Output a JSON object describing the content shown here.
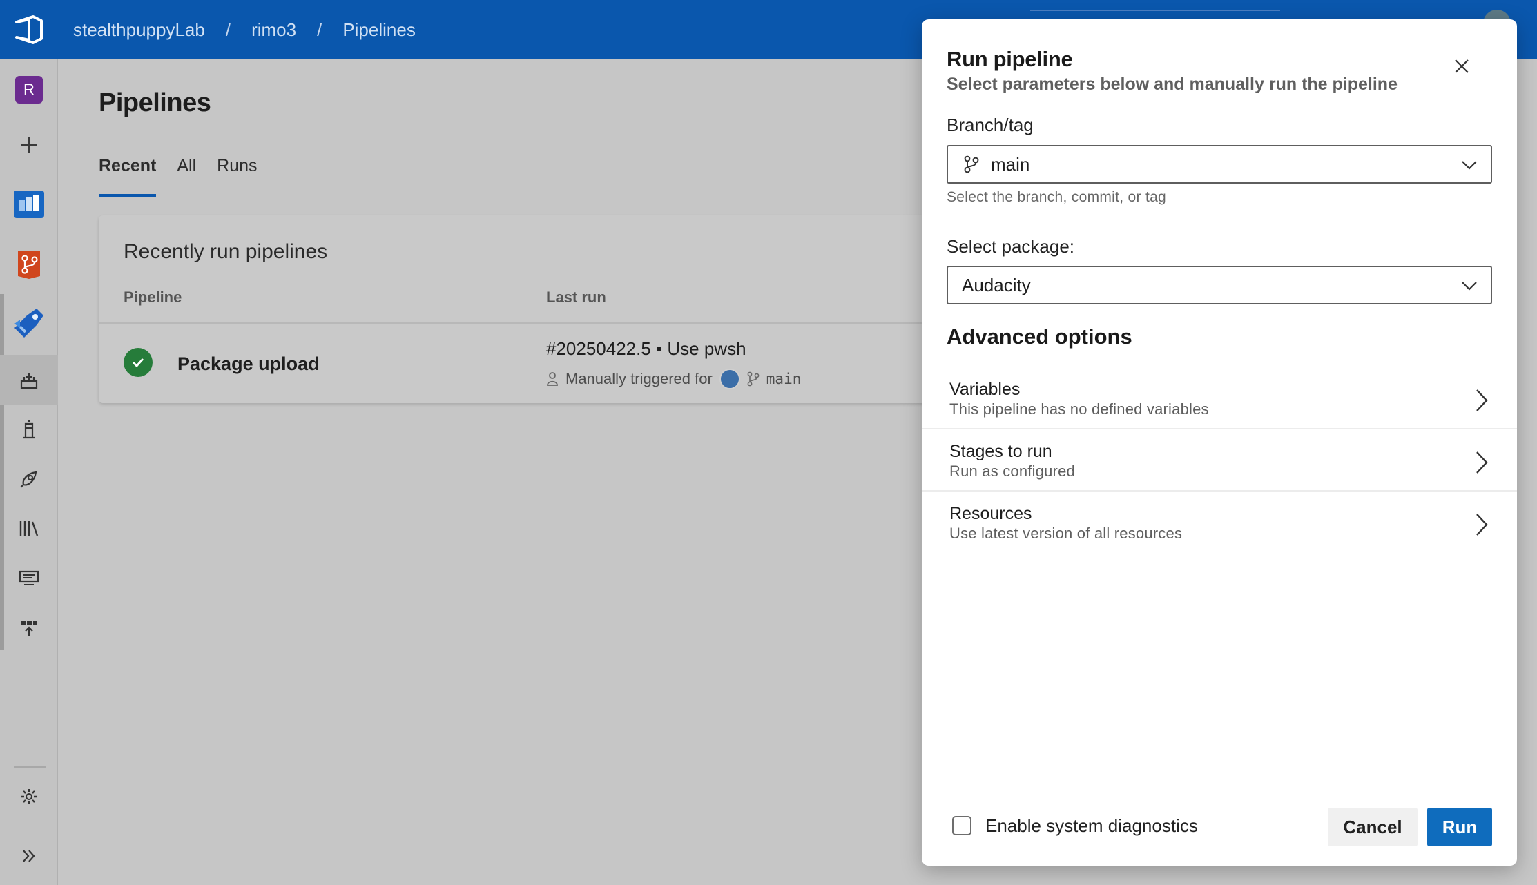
{
  "breadcrumb": {
    "org": "stealthpuppyLab",
    "project": "rimo3",
    "page": "Pipelines",
    "separator": "/"
  },
  "rail": {
    "project_initial": "R",
    "items": [
      {
        "icon": "plus-icon"
      },
      {
        "icon": "boards-icon",
        "color": "#0a66c6"
      },
      {
        "icon": "repos-icon",
        "color": "#d04a1f"
      },
      {
        "icon": "pipelines-icon",
        "color": "#1c64c4"
      },
      {
        "icon": "pipelines-list-icon"
      },
      {
        "icon": "environments-icon"
      },
      {
        "icon": "releases-icon"
      },
      {
        "icon": "library-icon"
      },
      {
        "icon": "task-groups-icon"
      },
      {
        "icon": "deployment-groups-icon"
      },
      {
        "icon": "settings-gear-icon"
      },
      {
        "icon": "expand-chevrons-icon"
      }
    ]
  },
  "main": {
    "title": "Pipelines",
    "tabs": [
      {
        "label": "Recent",
        "selected": true
      },
      {
        "label": "All",
        "selected": false
      },
      {
        "label": "Runs",
        "selected": false
      }
    ],
    "card": {
      "title": "Recently run pipelines",
      "columns": [
        "Pipeline",
        "Last run"
      ],
      "rows": [
        {
          "name": "Package upload",
          "status": "succeeded",
          "run_name": "#20250422.5 • Use pwsh",
          "trigger_text": "Manually triggered for",
          "branch": "main"
        }
      ]
    }
  },
  "dialog": {
    "title": "Run pipeline",
    "subtitle": "Select parameters below and manually run the pipeline",
    "branch_label": "Branch/tag",
    "branch_value": "main",
    "branch_helper": "Select the branch, commit, or tag",
    "package_label": "Select package:",
    "package_value": "Audacity",
    "advanced_title": "Advanced options",
    "options": [
      {
        "title": "Variables",
        "desc": "This pipeline has no defined variables"
      },
      {
        "title": "Stages to run",
        "desc": "Run as configured"
      },
      {
        "title": "Resources",
        "desc": "Use latest version of all resources"
      }
    ],
    "diagnostics_label": "Enable system diagnostics",
    "diagnostics_checked": false,
    "cancel_label": "Cancel",
    "run_label": "Run",
    "accent": "#0f6cbd"
  }
}
